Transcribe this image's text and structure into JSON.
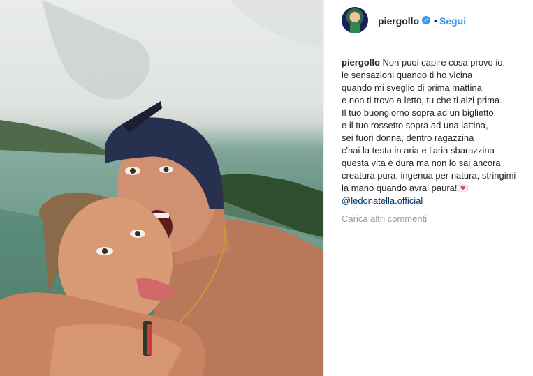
{
  "post": {
    "username": "piergollo",
    "verified_icon": "verified-badge-icon",
    "separator": "•",
    "follow_label": "Segui"
  },
  "caption": {
    "username": "piergollo",
    "lines": [
      "Non puoi capire cosa provo io,",
      "le sensazioni quando ti ho vicina",
      "quando mi sveglio di prima mattina",
      "e non ti trovo a letto, tu che ti alzi prima.",
      "Il tuo buongiorno sopra ad un biglietto",
      "e il tuo rossetto sopra ad una lattina,",
      "sei fuori donna, dentro ragazzina",
      "c'hai la testa in aria e l'aria sbarazzina",
      "questa vita è dura ma non lo sai ancora",
      "creatura pura, ingenua per natura, stringimi",
      "la mano quando avrai paura!💌"
    ],
    "mention": "@ledonatella.official"
  },
  "comments": {
    "load_more_label": "Carica altri commenti"
  },
  "colors": {
    "link": "#3897f0",
    "mention": "#003569",
    "muted": "#999999"
  }
}
